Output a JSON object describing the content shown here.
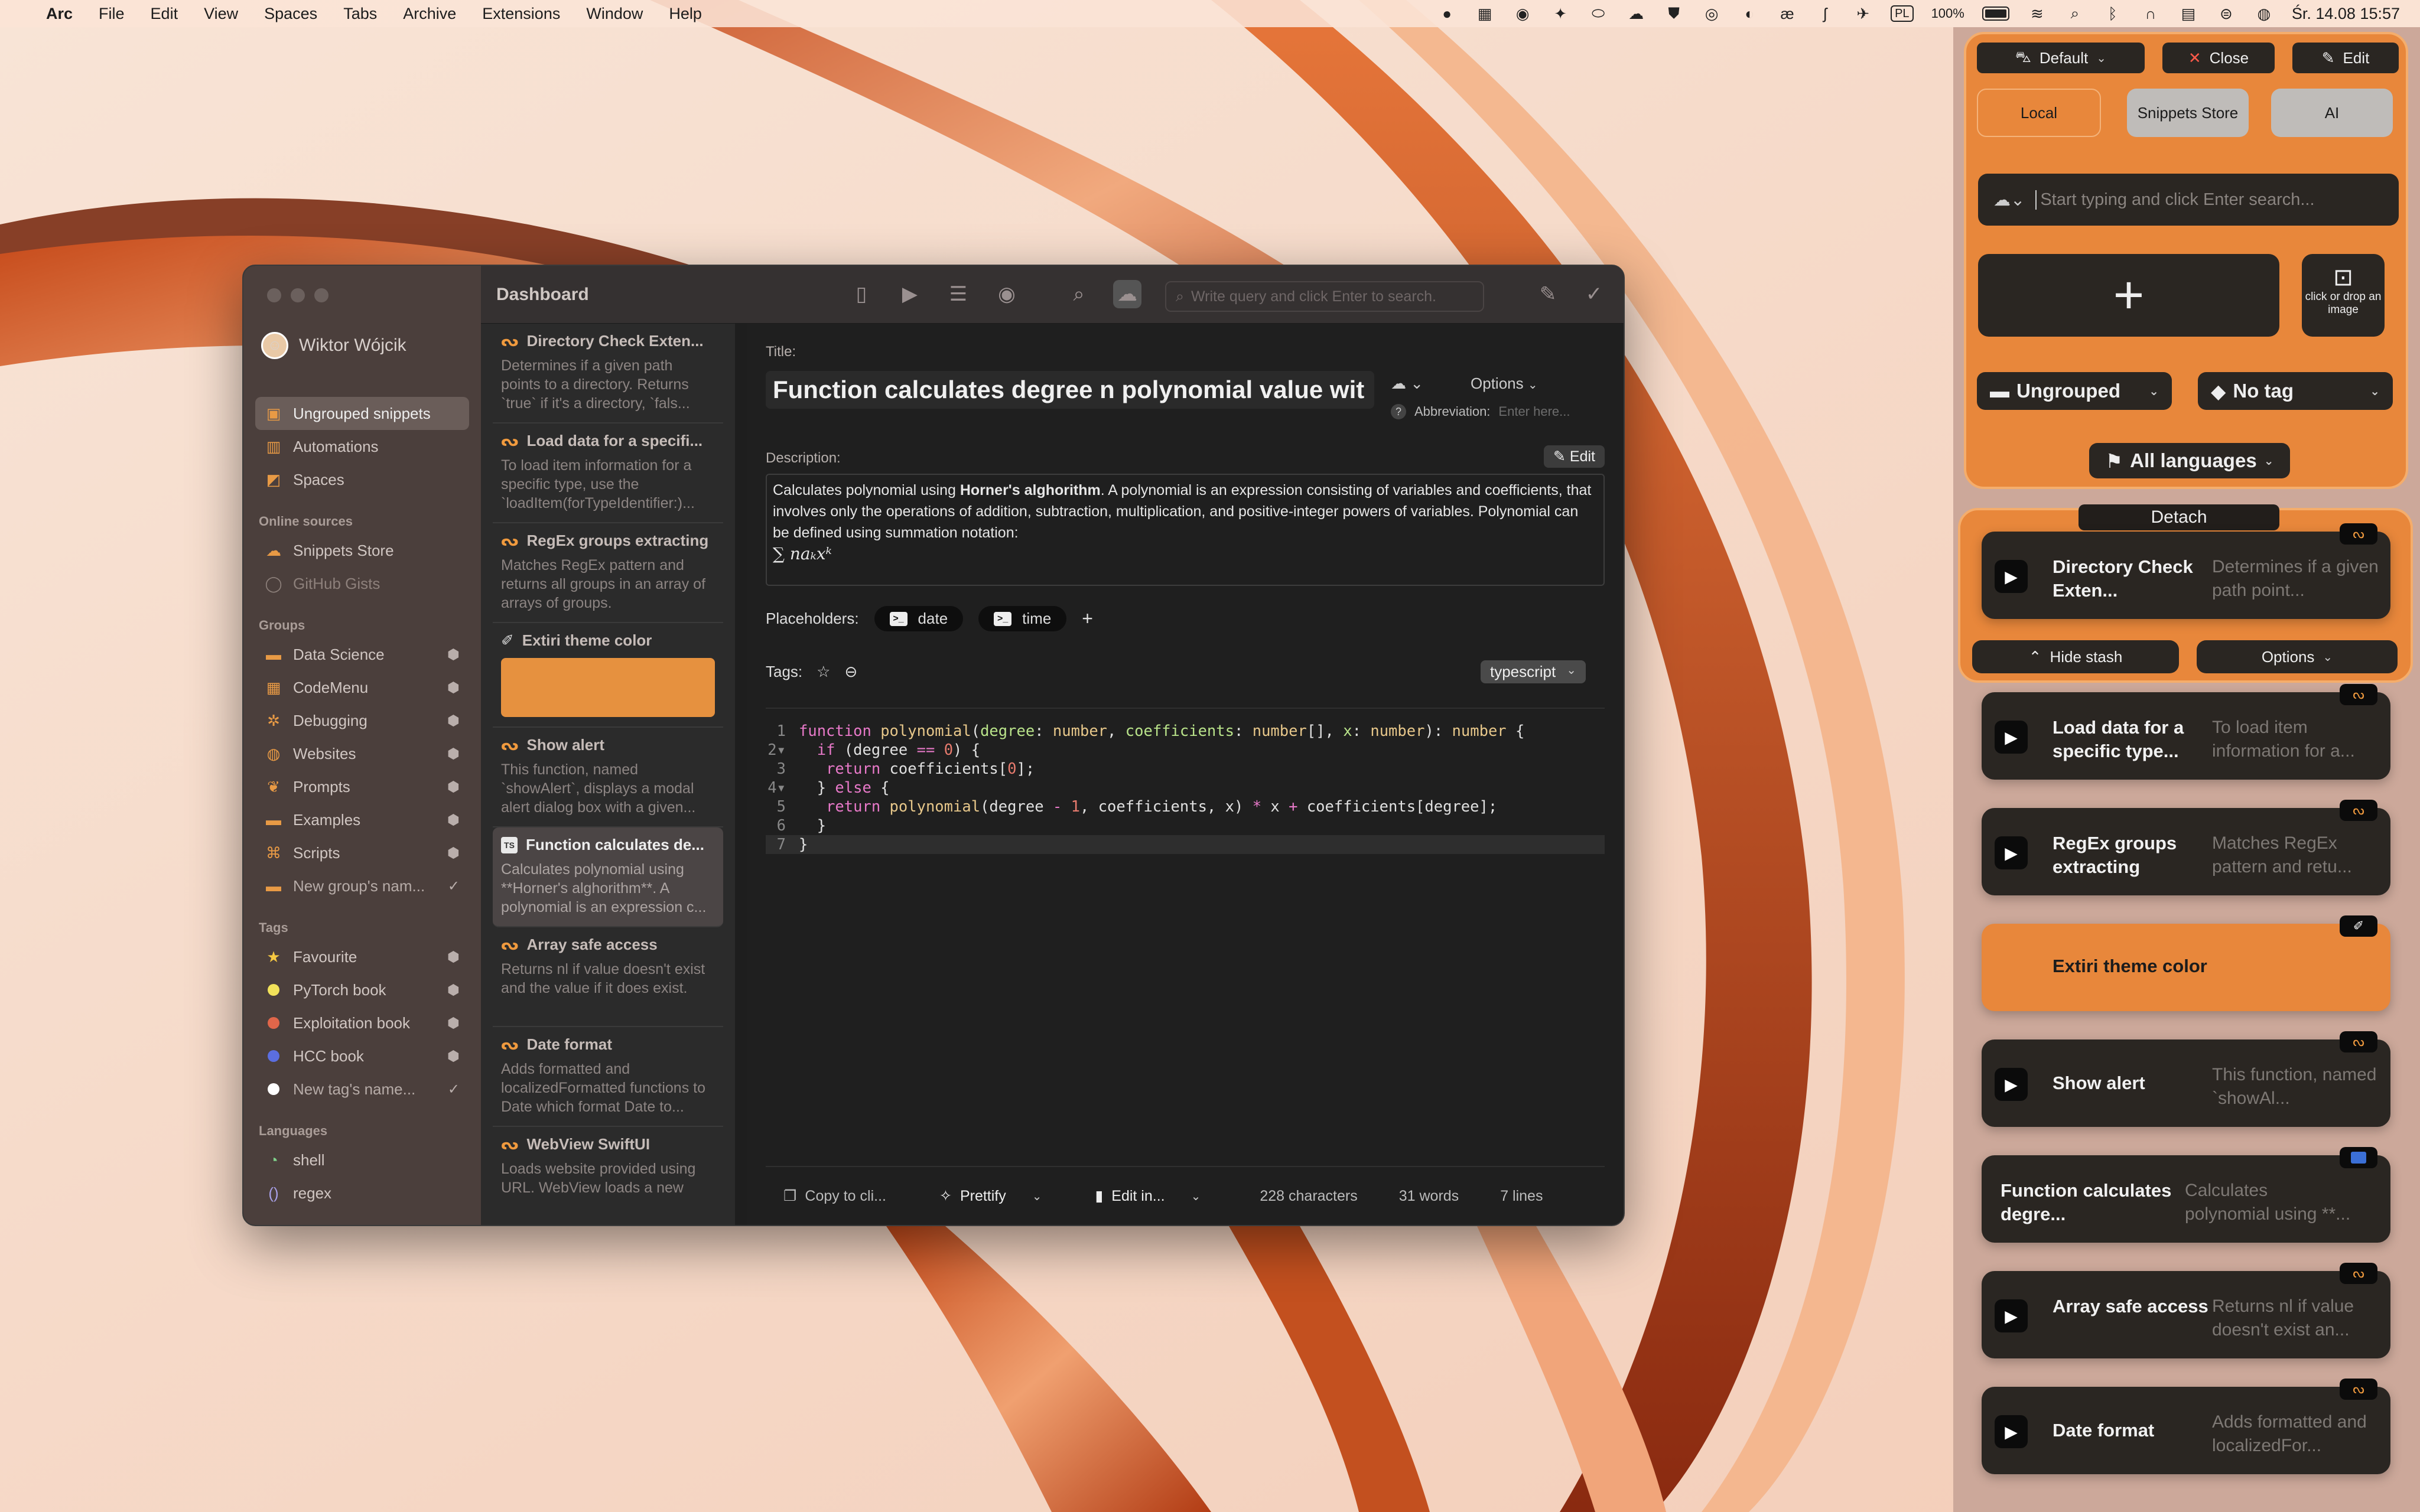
{
  "menubar": {
    "app": "Arc",
    "items": [
      "File",
      "Edit",
      "View",
      "Spaces",
      "Tabs",
      "Archive",
      "Extensions",
      "Window",
      "Help"
    ],
    "status": {
      "lang": "PL",
      "battery": "100%",
      "datetime": "Śr. 14.08  15:57"
    }
  },
  "window": {
    "user": "Wiktor Wójcik",
    "sidebar": {
      "main": [
        {
          "label": "Ungrouped snippets",
          "icon": "inbox-icon"
        },
        {
          "label": "Automations",
          "icon": "automation-icon"
        },
        {
          "label": "Spaces",
          "icon": "spaces-icon"
        }
      ],
      "online_heading": "Online sources",
      "online": [
        {
          "label": "Snippets Store",
          "icon": "cloud-icon"
        },
        {
          "label": "GitHub Gists",
          "icon": "github-icon"
        }
      ],
      "groups_heading": "Groups",
      "groups": [
        {
          "label": "Data Science"
        },
        {
          "label": "CodeMenu"
        },
        {
          "label": "Debugging"
        },
        {
          "label": "Websites"
        },
        {
          "label": "Prompts"
        },
        {
          "label": "Examples"
        },
        {
          "label": "Scripts"
        },
        {
          "label": "New group's nam..."
        }
      ],
      "tags_heading": "Tags",
      "tags": [
        {
          "label": "Favourite",
          "color": "#f5c842"
        },
        {
          "label": "PyTorch book",
          "color": "#f2e25a"
        },
        {
          "label": "Exploitation book",
          "color": "#e0664a"
        },
        {
          "label": "HCC book",
          "color": "#5b6ee0"
        },
        {
          "label": "New tag's name...",
          "color": "#ffffff"
        }
      ],
      "languages_heading": "Languages",
      "languages": [
        {
          "label": "shell"
        },
        {
          "label": "regex"
        }
      ]
    },
    "toolbar": {
      "title": "Dashboard",
      "search_placeholder": "Write query and click Enter to search."
    },
    "snippets": [
      {
        "title": "Directory Check Exten...",
        "desc": "Determines if a given path points to a directory. Returns `true` if it's a directory, `fals..."
      },
      {
        "title": "Load data for a specifi...",
        "desc": "To load item information for a specific type, use the `loadItem(forTypeIdentifier:)..."
      },
      {
        "title": "RegEx groups extracting",
        "desc": "Matches RegEx pattern and returns all groups in an array of arrays of groups."
      },
      {
        "title": "Extiri theme color",
        "desc": ""
      },
      {
        "title": "Show alert",
        "desc": "This function, named `showAlert`, displays a modal alert dialog box with a given..."
      },
      {
        "title": "Function calculates de...",
        "desc": "Calculates polynomial using **Horner's alghorithm**. A polynomial is an expression c..."
      },
      {
        "title": "Array safe access",
        "desc": "Returns nl if value doesn't exist and the value if it does exist."
      },
      {
        "title": "Date format",
        "desc": "Adds formatted and localizedFormatted functions to Date which format Date to..."
      },
      {
        "title": "WebView SwiftUI",
        "desc": "Loads website provided using URL. WebView loads a new"
      }
    ],
    "detail": {
      "title_label": "Title:",
      "title": "Function calculates degree n polynomial value wit",
      "options": "Options",
      "abbreviation_label": "Abbreviation:",
      "abbreviation_placeholder": "Enter here...",
      "description_label": "Description:",
      "edit": "Edit",
      "description_pre": "Calculates polynomial using ",
      "description_bold": "Horner's alghorithm",
      "description_post": ". A polynomial is an expression consisting of variables and coefficients, that involves only the operations of addition, subtraction, multiplication, and positive-integer powers of variables. Polynomial can be defined using summation notation:",
      "formula": "∑ naₖxᵏ",
      "placeholders_label": "Placeholders:",
      "placeholders": [
        "date",
        "time"
      ],
      "tags_label": "Tags:",
      "language": "typescript",
      "code": [
        "function polynomial(degree: number, coefficients: number[], x: number): number {",
        "  if (degree == 0) {",
        "   return coefficients[0];",
        "  } else {",
        "   return polynomial(degree - 1, coefficients, x) * x + coefficients[degree];",
        "  }",
        "}"
      ],
      "footer": {
        "copy": "Copy to cli...",
        "prettify": "Prettify",
        "edit_in": "Edit in...",
        "characters": "228 characters",
        "words": "31 words",
        "lines": "7 lines"
      }
    }
  },
  "panel": {
    "profile": "Default",
    "close": "Close",
    "edit": "Edit",
    "tabs": [
      "Local",
      "Snippets Store",
      "AI"
    ],
    "search_placeholder": "Start typing and click Enter search...",
    "drop_image": "click or drop an image",
    "group_filter": "Ungrouped",
    "tag_filter": "No tag",
    "language_filter": "All languages",
    "detach": "Detach",
    "hide_stash": "Hide stash",
    "stash_options": "Options",
    "cards": [
      {
        "title": "Directory Check Exten...",
        "desc": "Determines if a given path point..."
      },
      {
        "title": "Load data for a specific type...",
        "desc": "To load item information for a..."
      },
      {
        "title": "RegEx groups extracting",
        "desc": "Matches RegEx pattern and retu..."
      },
      {
        "title": "Extiri theme color",
        "desc": ""
      },
      {
        "title": "Show alert",
        "desc": "This function, named `showAl..."
      },
      {
        "title": "Function calculates degre...",
        "desc": "Calculates polynomial using **..."
      },
      {
        "title": "Array safe access",
        "desc": "Returns nl if value doesn't exist an..."
      },
      {
        "title": "Date format",
        "desc": "Adds formatted and localizedFor..."
      }
    ]
  },
  "colors": {
    "accent": "#e8873b",
    "theme_color": "#e6913f"
  }
}
